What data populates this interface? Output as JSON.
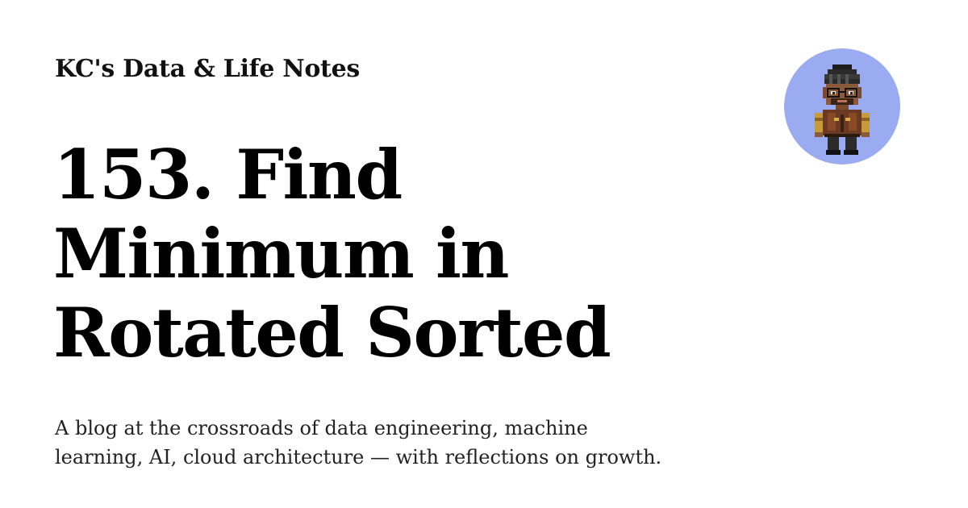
{
  "site": {
    "name": "KC's Data & Life Notes"
  },
  "post": {
    "title_lines": [
      "153. Find",
      "Minimum in",
      "Rotated Sorted"
    ]
  },
  "description": {
    "lines": [
      "A blog at the crossroads of data engineering, machine",
      "learning, AI, cloud architecture — with reflections on growth."
    ]
  },
  "avatar": {
    "icon": "pixel-art-character-avatar",
    "background_color": "#9aabf2"
  }
}
